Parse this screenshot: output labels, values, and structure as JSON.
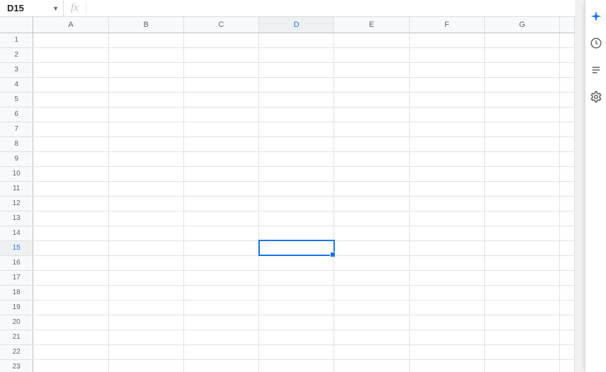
{
  "name_box": {
    "cell_ref": "D15"
  },
  "formula_bar": {
    "fx_label": "fx",
    "value": ""
  },
  "columns": [
    "A",
    "B",
    "C",
    "D",
    "E",
    "F",
    "G"
  ],
  "rows": [
    "1",
    "2",
    "3",
    "4",
    "5",
    "6",
    "7",
    "8",
    "9",
    "10",
    "11",
    "12",
    "13",
    "14",
    "15",
    "16",
    "17",
    "18",
    "19",
    "20",
    "21",
    "22",
    "23"
  ],
  "selection": {
    "col": "D",
    "row": "15"
  },
  "side_panel": {
    "items": [
      "gemini",
      "history",
      "list",
      "settings"
    ]
  }
}
